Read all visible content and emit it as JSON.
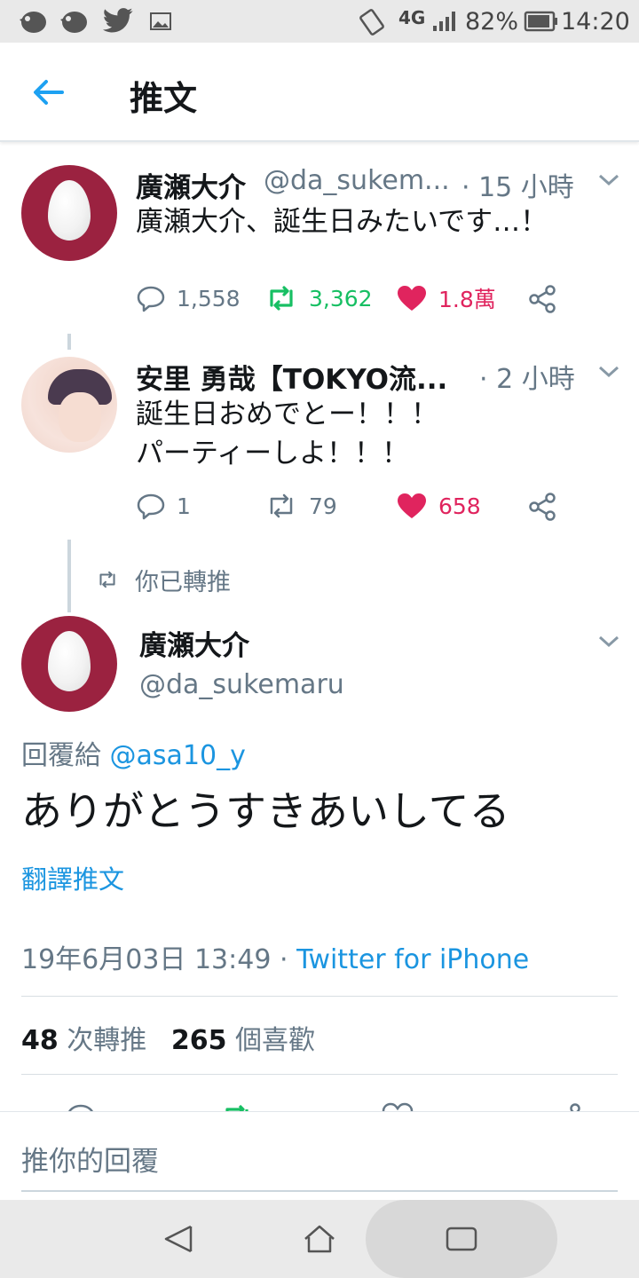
{
  "status_bar": {
    "network": "4G",
    "battery": "82%",
    "time": "14:20",
    "icons": [
      "bird-app-icon",
      "bird-app-icon",
      "twitter-icon",
      "image-icon",
      "rotate-icon",
      "signal-icon",
      "battery-icon"
    ]
  },
  "app_bar": {
    "title": "推文",
    "back_icon": "back-arrow-icon"
  },
  "thread": [
    {
      "name": "廣瀬大介",
      "handle": "@da_sukem...",
      "time": "· 15 小時",
      "text": [
        "廣瀬大介、誕生日みたいです…！"
      ],
      "replies": "1,558",
      "retweets": "3,362",
      "likes": "1.8萬",
      "retweeted": true,
      "liked": true
    },
    {
      "name": "安里 勇哉【TOKYO流...",
      "handle": "",
      "time": "· 2 小時",
      "text": [
        "誕生日おめでとー！！！",
        "パーティーしよ！！！"
      ],
      "replies": "1",
      "retweets": "79",
      "likes": "658",
      "retweeted": false,
      "liked": true
    }
  ],
  "focused": {
    "retweeted_label": "你已轉推",
    "name": "廣瀬大介",
    "handle": "@da_sukemaru",
    "reply_to_label": "回覆給",
    "reply_to_handle": "@asa10_y",
    "text": "ありがとうすきあいしてる",
    "translate": "翻譯推文",
    "date": "19年6月03日 13:49",
    "separator": "·",
    "client": "Twitter for iPhone",
    "retweet_count": "48",
    "retweet_label": "次轉推",
    "like_count": "265",
    "like_label": "個喜歡"
  },
  "reply_box": {
    "placeholder": "推你的回覆"
  },
  "colors": {
    "accent": "#1da1f2",
    "link": "#1b95e0",
    "like": "#e0245e",
    "retweet": "#17bf63",
    "secondary_text": "#657786"
  }
}
